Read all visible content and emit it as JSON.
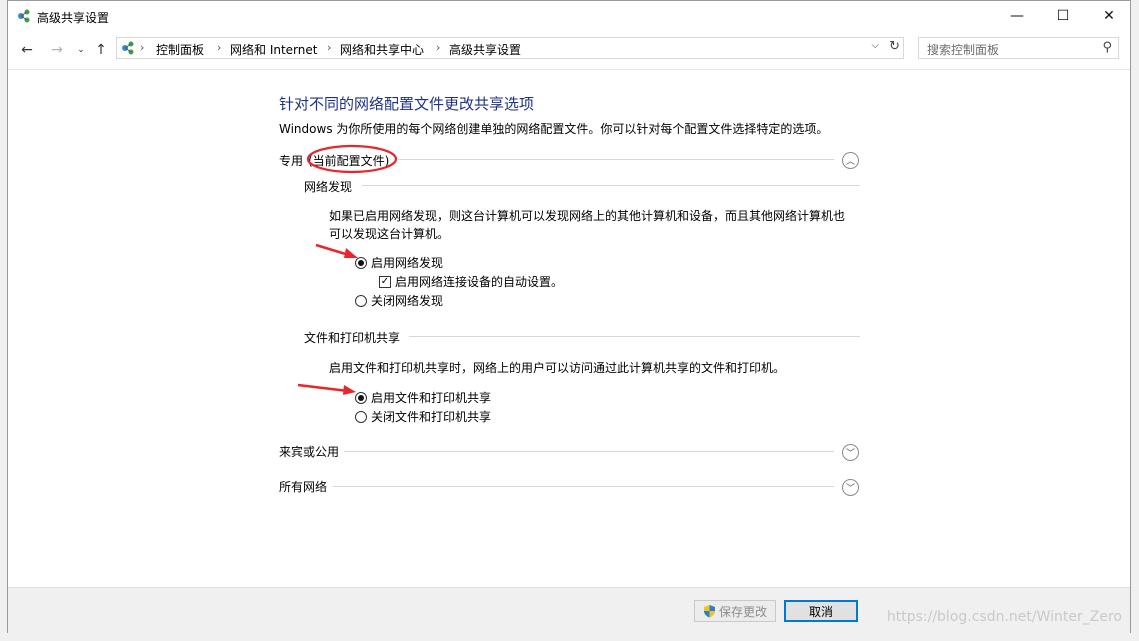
{
  "window": {
    "title": "高级共享设置",
    "controls": {
      "minimize": "—",
      "maximize": "☐",
      "close": "✕"
    }
  },
  "nav": {
    "breadcrumbs": [
      "控制面板",
      "网络和 Internet",
      "网络和共享中心",
      "高级共享设置"
    ],
    "search_placeholder": "搜索控制面板"
  },
  "page": {
    "heading": "针对不同的网络配置文件更改共享选项",
    "description": "Windows 为你所使用的每个网络创建单独的网络配置文件。你可以针对每个配置文件选择特定的选项。",
    "profiles": {
      "private": {
        "label": "专用",
        "current_tag": "(当前配置文件)",
        "expanded": true,
        "network_discovery": {
          "title": "网络发现",
          "text_line1": "如果已启用网络发现，则这台计算机可以发现网络上的其他计算机和设备，而且其他网络计算机也",
          "text_line2": "可以发现这台计算机。",
          "option_on": "启用网络发现",
          "auto_setup": "启用网络连接设备的自动设置。",
          "option_off": "关闭网络发现",
          "selected": "on",
          "auto_setup_checked": true
        },
        "file_sharing": {
          "title": "文件和打印机共享",
          "text": "启用文件和打印机共享时，网络上的用户可以访问通过此计算机共享的文件和打印机。",
          "option_on": "启用文件和打印机共享",
          "option_off": "关闭文件和打印机共享",
          "selected": "on"
        }
      },
      "guest": {
        "label": "来宾或公用",
        "expanded": false
      },
      "all": {
        "label": "所有网络",
        "expanded": false
      }
    }
  },
  "footer": {
    "save_label": "保存更改",
    "cancel_label": "取消"
  },
  "watermark": "https://blog.csdn.net/Winter_Zero",
  "colors": {
    "heading": "#1e3287",
    "accent": "#0078d7",
    "annotation": "#e8262b"
  }
}
